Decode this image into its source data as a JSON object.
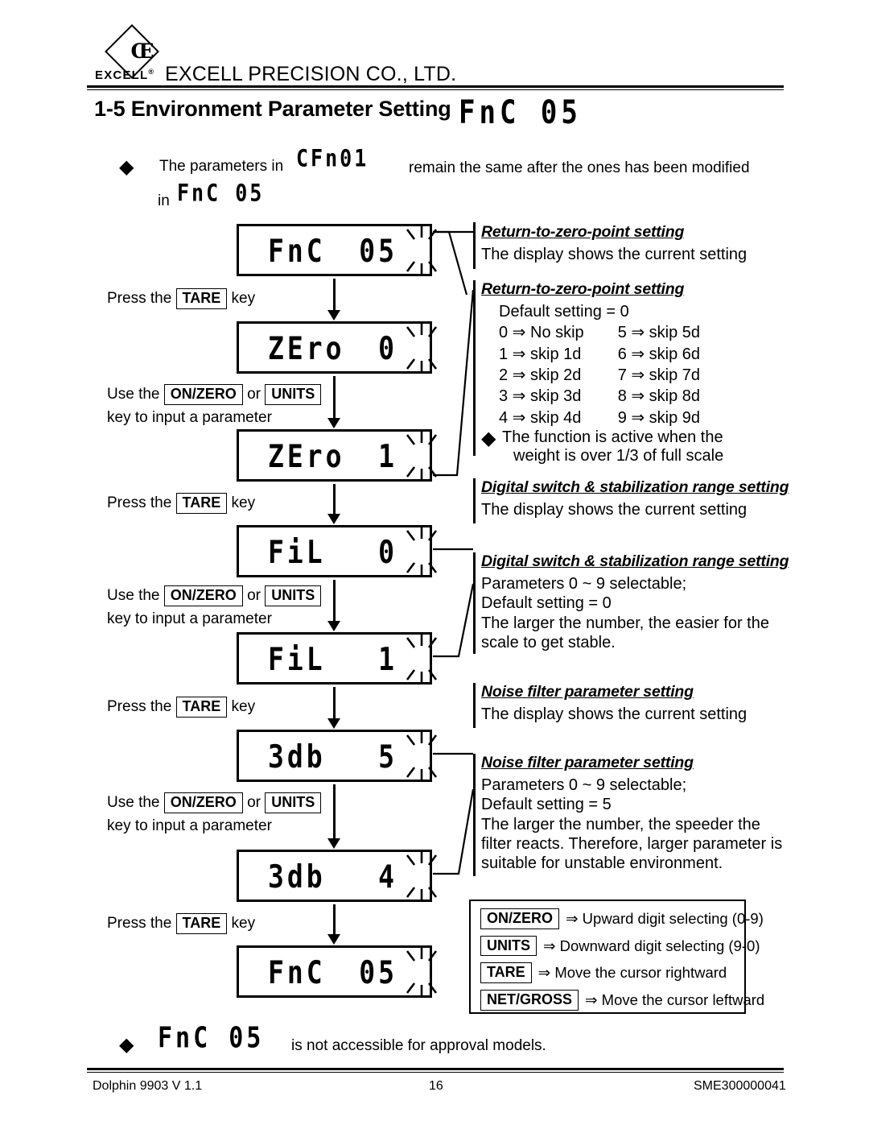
{
  "header": {
    "logo_text": "EXCELL",
    "logo_sup": "®",
    "logo_mark": "CE",
    "company": "EXCELL PRECISION CO., LTD."
  },
  "section": {
    "number_title": "1-5 Environment Parameter Setting",
    "title_code": "FnC  05"
  },
  "top_note": {
    "bullet": "◆",
    "part1": "The parameters in",
    "code1": "CFn01",
    "part2": "remain the same after the ones has been modified",
    "part3": "in",
    "code2": "FnC  05"
  },
  "flow": {
    "steps": [
      {
        "label": "FnC",
        "value": "05",
        "blink": true
      },
      {
        "label": "ZEro",
        "value": "0",
        "blink": true
      },
      {
        "label": "ZEro",
        "value": "1",
        "blink": true
      },
      {
        "label": "FiL",
        "value": "0",
        "blink": true
      },
      {
        "label": "FiL",
        "value": "1",
        "blink": true
      },
      {
        "label": "3db",
        "value": "5",
        "blink": true
      },
      {
        "label": "3db",
        "value": "4",
        "blink": true
      },
      {
        "label": "FnC",
        "value": "05",
        "blink": true
      }
    ],
    "instructions": [
      {
        "pre": "Press the",
        "keys": [
          "TARE"
        ],
        "post": "key",
        "line2": ""
      },
      {
        "pre": "Use the",
        "keys": [
          "ON/ZERO",
          "UNITS"
        ],
        "post": "",
        "line2": "key to input a parameter"
      },
      {
        "pre": "Press the",
        "keys": [
          "TARE"
        ],
        "post": "key",
        "line2": ""
      },
      {
        "pre": "Use the",
        "keys": [
          "ON/ZERO",
          "UNITS"
        ],
        "post": "",
        "line2": "key to input a parameter"
      },
      {
        "pre": "Press the",
        "keys": [
          "TARE"
        ],
        "post": "key",
        "line2": ""
      },
      {
        "pre": "Use the",
        "keys": [
          "ON/ZERO",
          "UNITS"
        ],
        "post": "",
        "line2": "key to input a parameter"
      },
      {
        "pre": "Press the",
        "keys": [
          "TARE"
        ],
        "post": "key",
        "line2": ""
      }
    ],
    "or_word": "or"
  },
  "descriptions": {
    "zero_current": {
      "heading": "Return-to-zero-point setting",
      "lines": [
        "The display shows the current setting"
      ]
    },
    "zero_detail": {
      "heading": "Return-to-zero-point setting",
      "default_line": "Default setting = 0",
      "skip_left": [
        "0 ⇒ No skip",
        "1 ⇒ skip 1d",
        "2 ⇒ skip 2d",
        "3 ⇒ skip 3d",
        "4 ⇒ skip 4d"
      ],
      "skip_right": [
        "5 ⇒ skip 5d",
        "6 ⇒ skip 6d",
        "7 ⇒ skip 7d",
        "8 ⇒ skip 8d",
        "9 ⇒ skip 9d"
      ],
      "note_bullet": "◆",
      "note_line1": "The function is active when the",
      "note_line2": "weight is over 1/3 of full scale"
    },
    "digital_current": {
      "heading": "Digital switch & stabilization range setting",
      "lines": [
        "The display shows the current setting"
      ]
    },
    "digital_detail": {
      "heading": "Digital switch & stabilization range setting",
      "lines": [
        "Parameters 0 ~ 9 selectable;",
        "Default setting = 0",
        "The larger the number, the easier for the",
        "scale to get stable."
      ]
    },
    "noise_current": {
      "heading": "Noise filter parameter setting",
      "lines": [
        "The display shows the current setting"
      ]
    },
    "noise_detail": {
      "heading": "Noise filter parameter setting",
      "lines": [
        "Parameters 0 ~ 9 selectable;",
        "Default setting = 5",
        "The larger the number, the speeder the",
        "filter reacts. Therefore, larger parameter is",
        "suitable for unstable environment."
      ]
    }
  },
  "legend": {
    "rows": [
      {
        "key": "ON/ZERO",
        "arrow": "⇒",
        "text": "Upward digit selecting (0-9)"
      },
      {
        "key": "UNITS",
        "arrow": "⇒",
        "text": "Downward digit selecting (9-0)"
      },
      {
        "key": "TARE",
        "arrow": "⇒",
        "text": "Move the cursor rightward"
      },
      {
        "key": "NET/GROSS",
        "arrow": "⇒",
        "text": "Move the cursor leftward"
      }
    ]
  },
  "bottom_note": {
    "bullet": "◆",
    "code": "FnC  05",
    "text": "is not accessible for approval models."
  },
  "footer": {
    "left": "Dolphin 9903 V 1.1",
    "center": "16",
    "right": "SME300000041"
  }
}
